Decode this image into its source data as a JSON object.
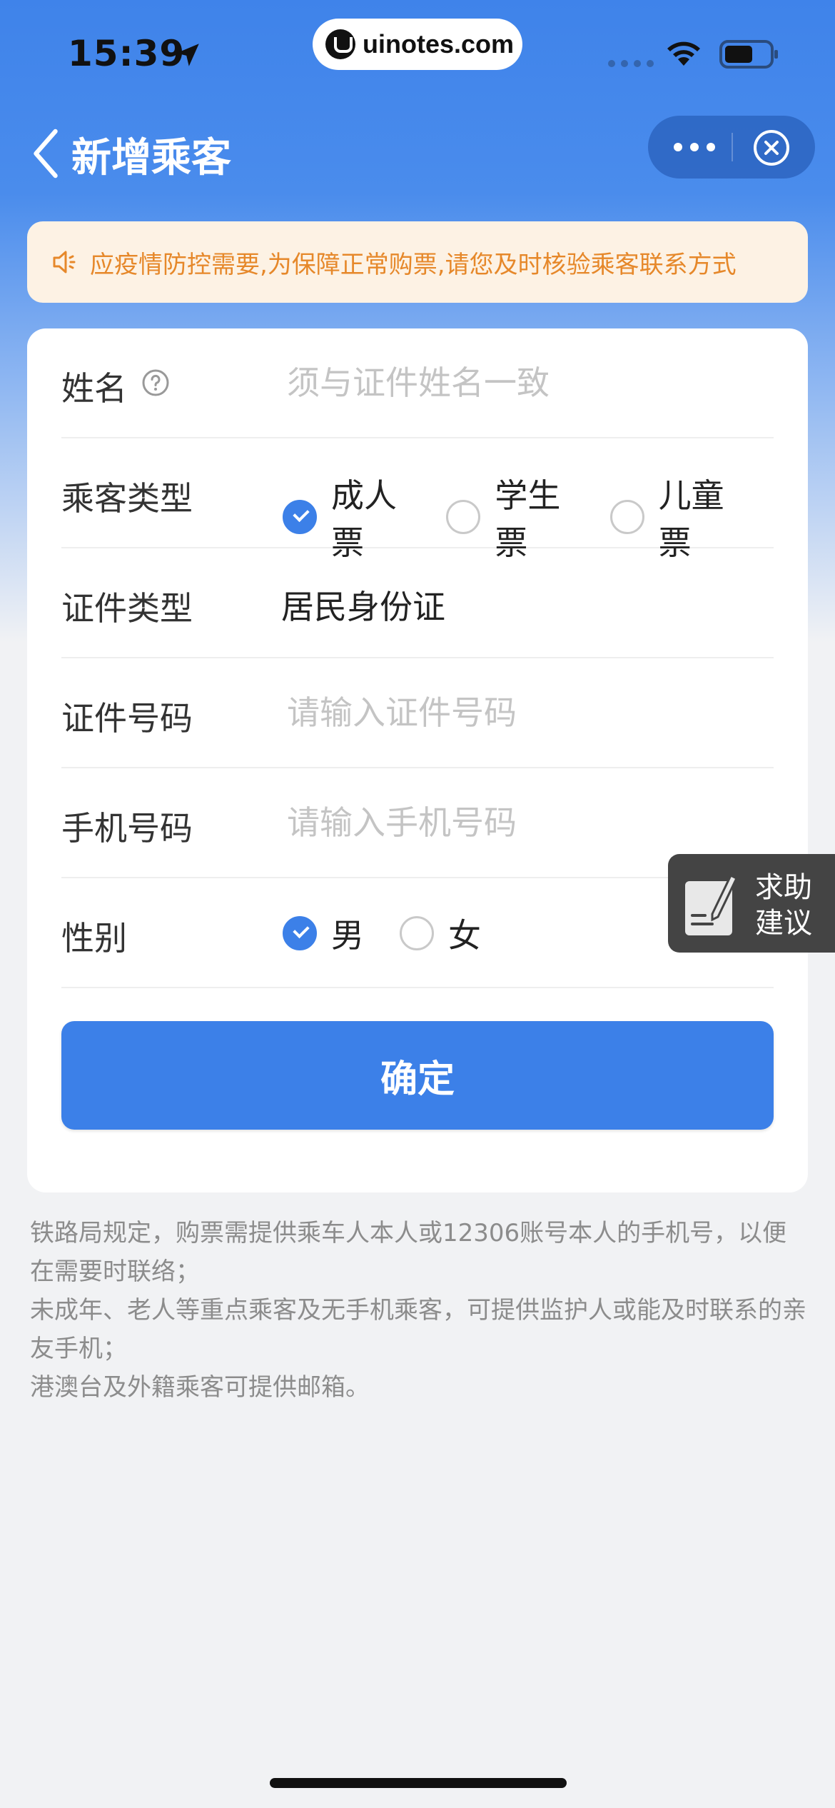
{
  "status_bar": {
    "time": "15:39",
    "pill_text": "uinotes.com"
  },
  "nav": {
    "title": "新增乘客"
  },
  "notice": {
    "text": "应疫情防控需要,为保障正常购票,请您及时核验乘客联系方式",
    "color": "#e6882a"
  },
  "form": {
    "name": {
      "label": "姓名",
      "placeholder": "须与证件姓名一致"
    },
    "passenger_type": {
      "label": "乘客类型",
      "options": [
        "成人票",
        "学生票",
        "儿童票"
      ],
      "selected": "成人票"
    },
    "id_type": {
      "label": "证件类型",
      "value": "居民身份证"
    },
    "id_number": {
      "label": "证件号码",
      "placeholder": "请输入证件号码"
    },
    "phone": {
      "label": "手机号码",
      "placeholder": "请输入手机号码"
    },
    "gender": {
      "label": "性别",
      "options": [
        "男",
        "女"
      ],
      "selected": "男"
    },
    "confirm_label": "确定"
  },
  "notes": [
    "铁路局规定，购票需提供乘车人本人或12306账号本人的手机号，以便在需要时联络；",
    "未成年、老人等重点乘客及无手机乘客，可提供监护人或能及时联系的亲友手机；",
    "港澳台及外籍乘客可提供邮箱。"
  ],
  "float_help": {
    "line1": "求助",
    "line2": "建议"
  },
  "colors": {
    "primary": "#3c80e8",
    "header": "#3f83ea",
    "notice_bg": "#fdf2e4"
  }
}
